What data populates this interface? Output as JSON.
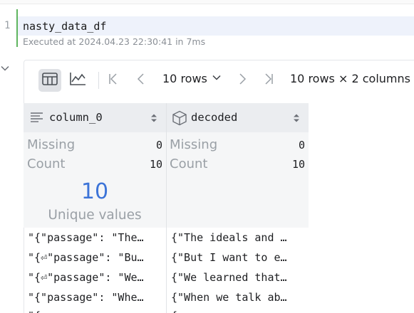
{
  "cell": {
    "line_number": "1",
    "code": "nasty_data_df",
    "exec_info": "Executed at 2024.04.23 22:30:41 in 7ms"
  },
  "toolbar": {
    "rows_label": "10 rows",
    "shape_info": "10 rows × 2 columns"
  },
  "table": {
    "columns": [
      {
        "name": "column_0",
        "type_icon": "text-align-icon",
        "missing_label": "Missing",
        "missing_value": "0",
        "count_label": "Count",
        "count_value": "10",
        "unique_count": "10",
        "unique_label": "Unique values"
      },
      {
        "name": "decoded",
        "type_icon": "cube-icon",
        "missing_label": "Missing",
        "missing_value": "0",
        "count_label": "Count",
        "count_value": "10"
      }
    ],
    "rows": [
      [
        "\"{\"passage\": \"The…",
        "{\"The ideals and …"
      ],
      [
        "\"{⏎\"passage\": \"Bu…",
        "{\"But I want to e…"
      ],
      [
        "\"{⏎\"passage\": \"We…",
        "{\"We learned that…"
      ],
      [
        "\"{\"passage\": \"Whe…",
        "{\"When we talk ab…"
      ],
      [
        "\"{",
        "{"
      ]
    ]
  },
  "colors": {
    "accent": "#3d74d8",
    "cell_bar": "#5fb55f",
    "header_bg": "#ebedf0"
  }
}
